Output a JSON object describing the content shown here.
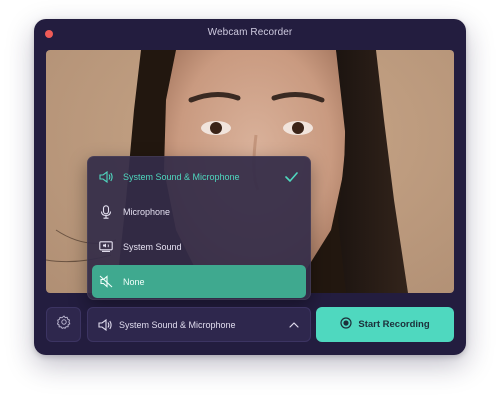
{
  "window": {
    "title": "Webcam Recorder"
  },
  "audio_menu": {
    "items": [
      {
        "label": "System Sound & Microphone",
        "icon": "speaker-icon",
        "state": "selected"
      },
      {
        "label": "Microphone",
        "icon": "microphone-icon",
        "state": "normal"
      },
      {
        "label": "System Sound",
        "icon": "system-sound-icon",
        "state": "normal"
      },
      {
        "label": "None",
        "icon": "speaker-muted-icon",
        "state": "highlighted"
      }
    ]
  },
  "controls": {
    "audio_select_value": "System Sound & Microphone",
    "record_label": "Start Recording"
  },
  "colors": {
    "accent": "#4fd8bf",
    "window_bg": "#231d3f",
    "menu_highlight": "#3fa98f",
    "close_dot": "#ef5b57"
  }
}
